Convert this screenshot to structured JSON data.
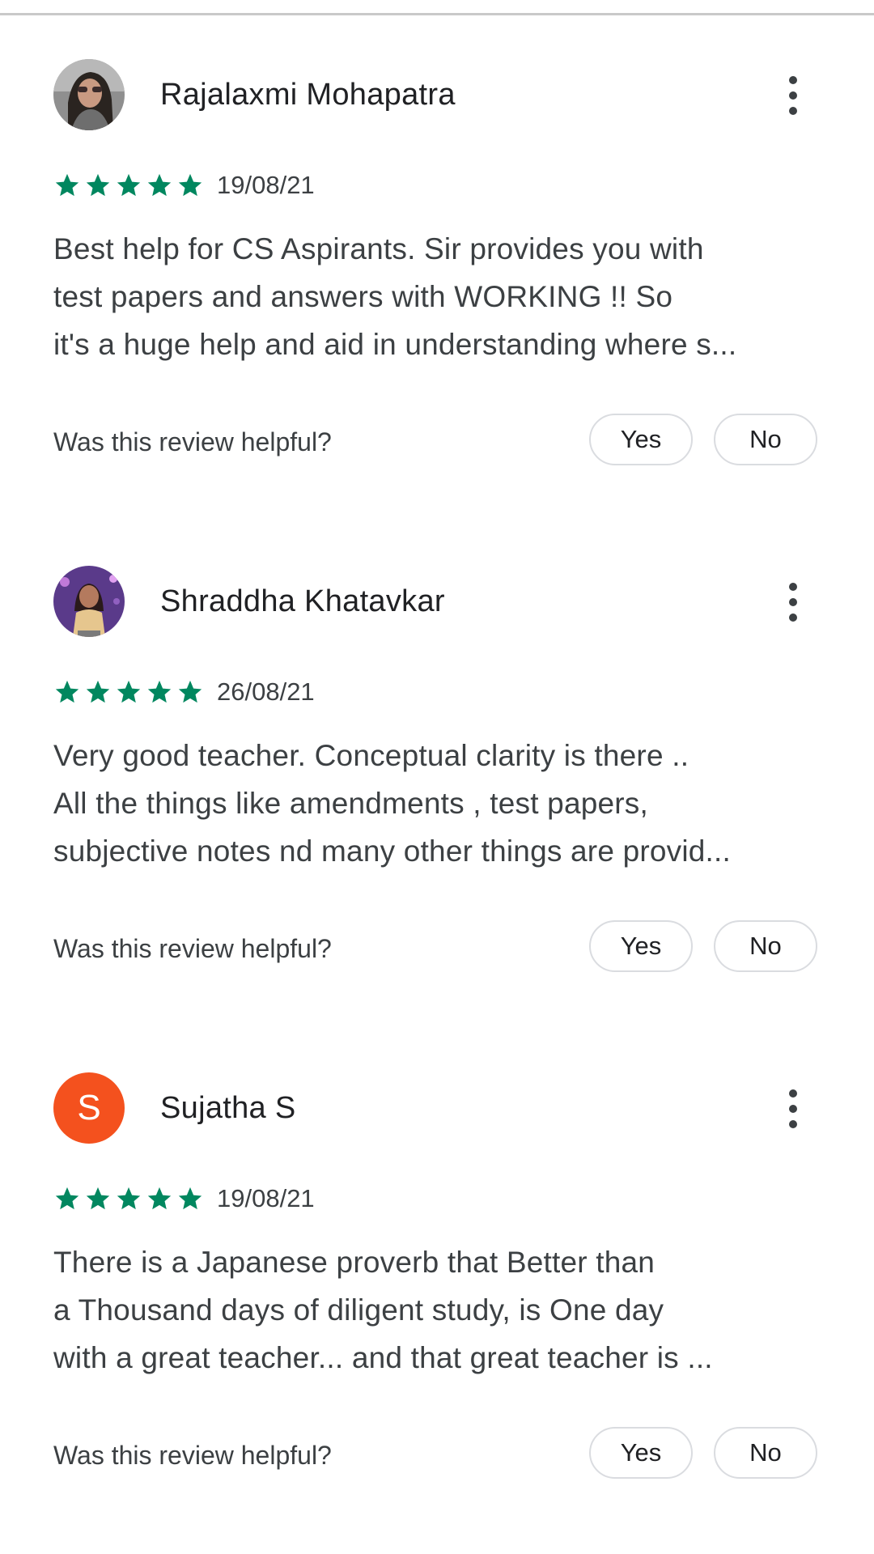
{
  "helpful_prompt": "Was this review helpful?",
  "yes_label": "Yes",
  "no_label": "No",
  "star_color": "#01875f",
  "reviews": [
    {
      "author": "Rajalaxmi Mohapatra",
      "avatar": "photo",
      "rating": 5,
      "date": "19/08/21",
      "text_lines": [
        "Best help for CS Aspirants. Sir provides you with",
        "test papers and answers with WORKING !! So",
        "it's a huge help and aid in understanding where s..."
      ]
    },
    {
      "author": "Shraddha Khatavkar",
      "avatar": "photo",
      "rating": 5,
      "date": "26/08/21",
      "text_lines": [
        "Very good teacher. Conceptual clarity is there ..",
        "All the things like amendments , test papers,",
        "subjective notes nd many other things are provid..."
      ]
    },
    {
      "author": "Sujatha S",
      "avatar": "letter",
      "avatar_letter": "S",
      "avatar_color": "#f4511e",
      "rating": 5,
      "date": "19/08/21",
      "text_lines": [
        "There is a Japanese proverb that Better than",
        "a Thousand days of diligent study, is One day",
        "with a great teacher... and that great teacher is ..."
      ]
    }
  ]
}
